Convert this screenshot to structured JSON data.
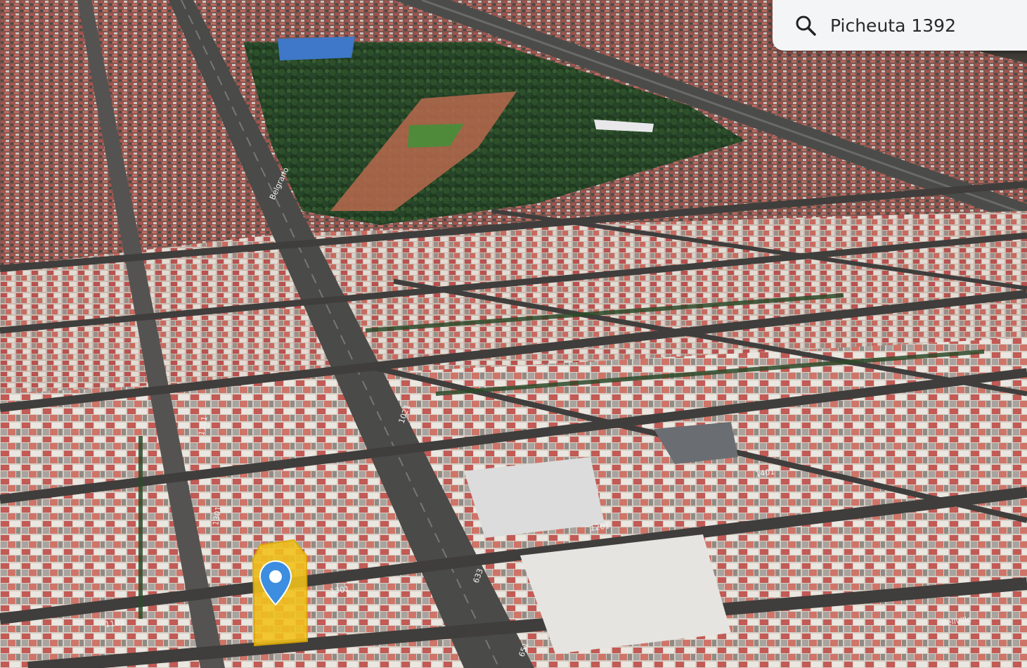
{
  "search": {
    "query": "Picheuta 1392",
    "icon": "search-icon"
  },
  "map": {
    "view": "3d-satellite",
    "highlight_color": "#f2c21a",
    "pin_color": "#3d8de0",
    "street_labels": [
      "1101",
      "1201",
      "1301",
      "1401",
      "1301",
      "1101",
      "633",
      "651",
      "1021",
      "Belgrano",
      "Bellville"
    ]
  }
}
